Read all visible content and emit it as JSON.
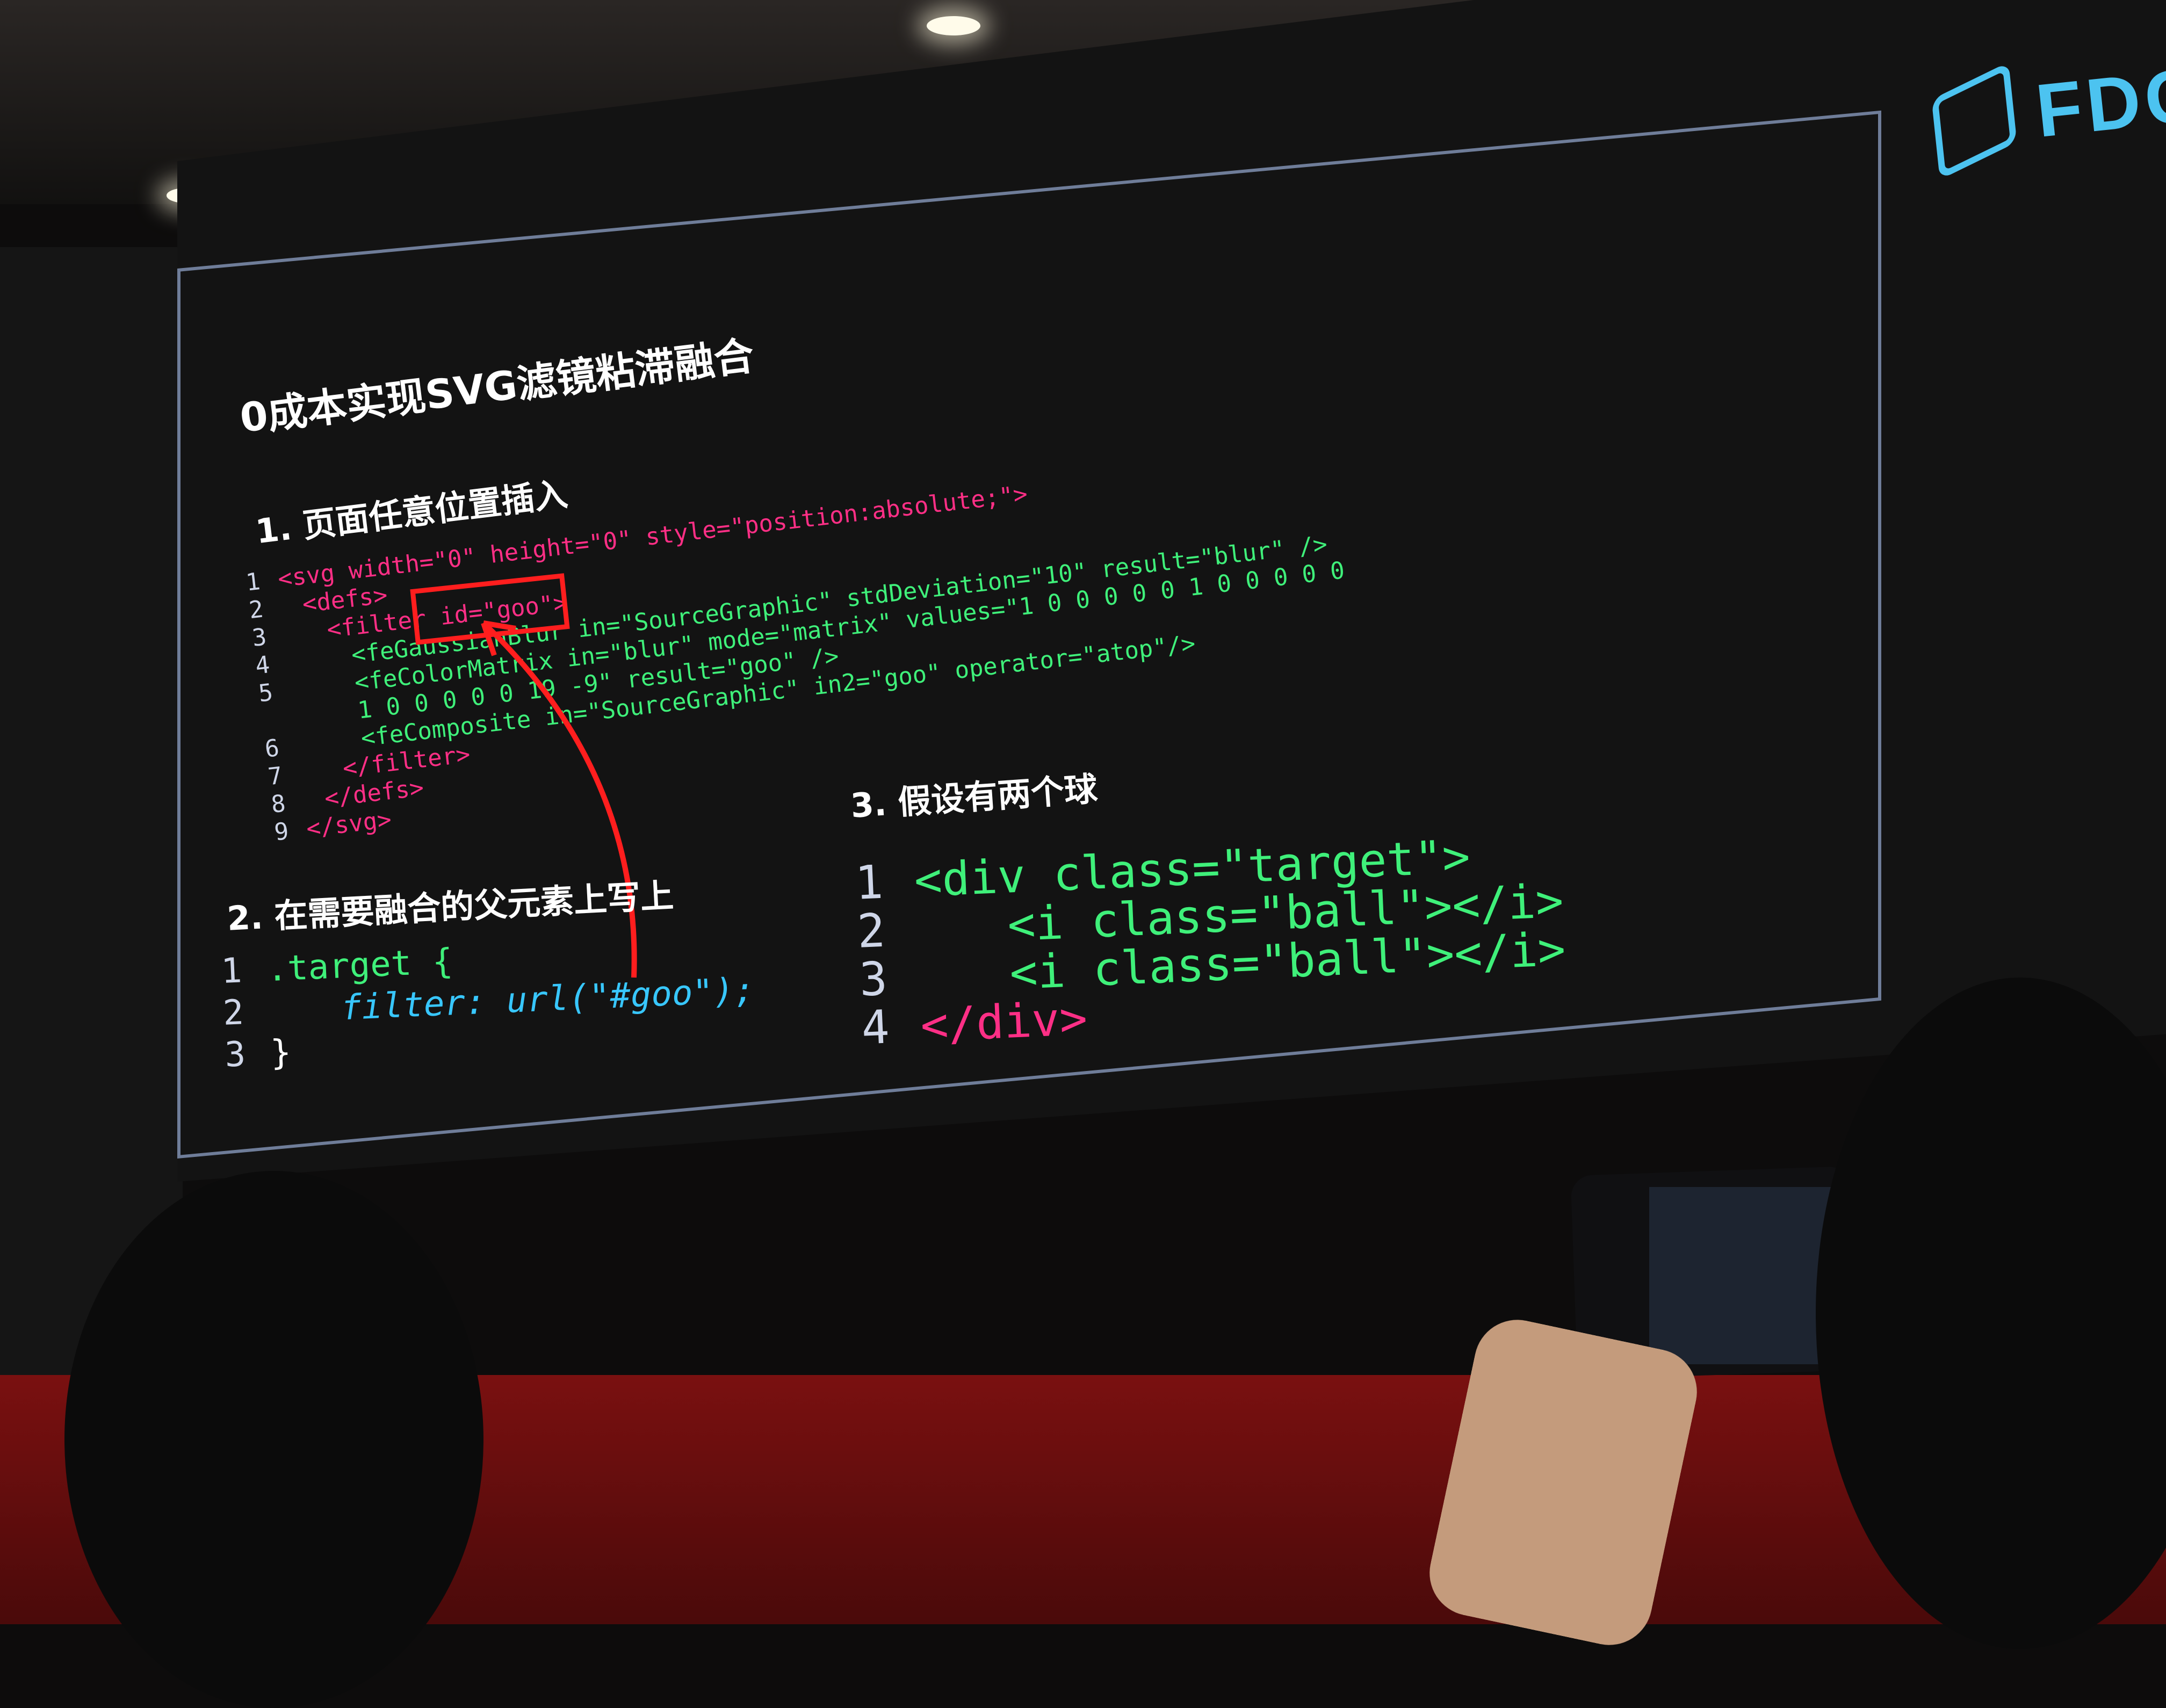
{
  "brand": {
    "text": "FDC"
  },
  "slide": {
    "title": "0成本实现SVG滤镜粘滞融合",
    "step1": {
      "heading": "1. 页面任意位置插入",
      "lines": [
        {
          "n": "1",
          "text": "<svg width=\"0\" height=\"0\" style=\"position:absolute;\">"
        },
        {
          "n": "2",
          "text": "<defs>"
        },
        {
          "n": "3",
          "text": "<filter id=\"goo\">"
        },
        {
          "n": "4",
          "text": "<feGaussianBlur in=\"SourceGraphic\" stdDeviation=\"10\" result=\"blur\" />"
        },
        {
          "n": "5",
          "text": "<feColorMatrix in=\"blur\" mode=\"matrix\" values=\"1 0 0 0 0  0 1 0 0 0  0 0 1 0 0  0 0 0 19 -9\" result=\"goo\" />"
        },
        {
          "n": "6",
          "text": "<feComposite in=\"SourceGraphic\" in2=\"goo\" operator=\"atop\"/>"
        },
        {
          "n": "7",
          "text": "</filter>"
        },
        {
          "n": "8",
          "text": "</defs>"
        },
        {
          "n": "9",
          "text": "</svg>"
        }
      ]
    },
    "step2": {
      "heading": "2. 在需要融合的父元素上写上",
      "lines": [
        {
          "n": "1",
          "text": ".target {"
        },
        {
          "n": "2",
          "text": "filter: url(\"#goo\");"
        },
        {
          "n": "3",
          "text": "}"
        }
      ]
    },
    "step3": {
      "heading": "3. 假设有两个球",
      "lines": [
        {
          "n": "1",
          "text": "<div class=\"target\">"
        },
        {
          "n": "2",
          "text": "<i class=\"ball\"></i>"
        },
        {
          "n": "3",
          "text": "<i class=\"ball\"></i>"
        },
        {
          "n": "4",
          "text": "</div>"
        }
      ]
    }
  },
  "colors": {
    "tag": "#ff2f86",
    "attr": "#3ff07a",
    "keyword": "#38c7ff",
    "highlight": "#ff1e1e",
    "brand": "#4cc3f0"
  }
}
